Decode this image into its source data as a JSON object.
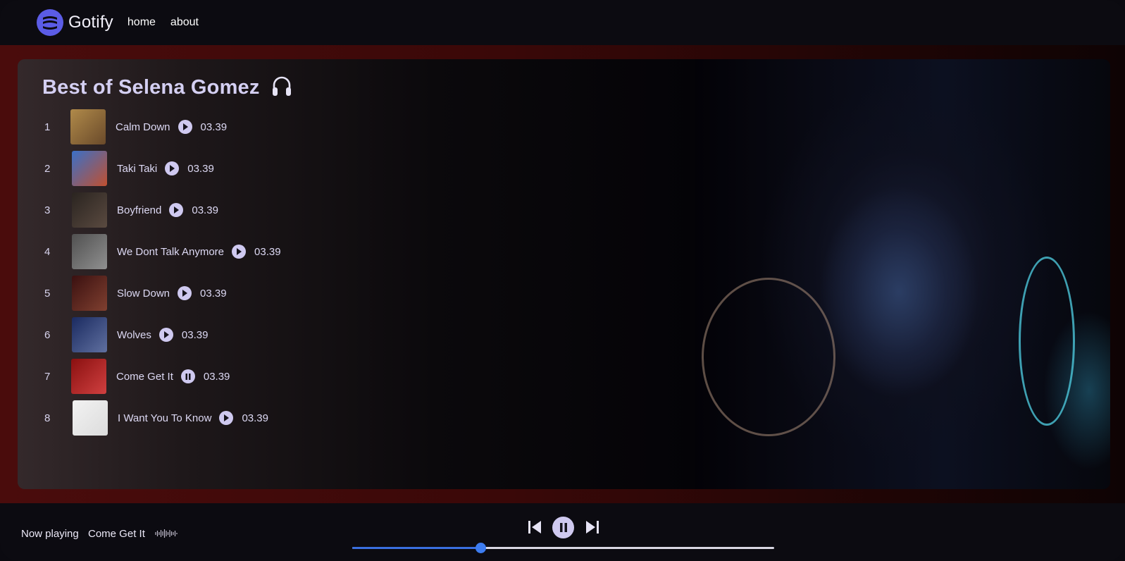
{
  "navbar": {
    "brand": "Gotify",
    "links": [
      "home",
      "about"
    ]
  },
  "playlist": {
    "title": "Best of Selena Gomez",
    "title_icon": "headphones-icon",
    "tracks": [
      {
        "num": "1",
        "name": "Calm Down",
        "duration": "03.39",
        "state": "play",
        "thumb_colors": [
          "#b08a4a",
          "#6a4a2a"
        ]
      },
      {
        "num": "2",
        "name": "Taki Taki",
        "duration": "03.39",
        "state": "play",
        "thumb_colors": [
          "#3a70c8",
          "#c05030"
        ]
      },
      {
        "num": "3",
        "name": "Boyfriend",
        "duration": "03.39",
        "state": "play",
        "thumb_colors": [
          "#2a2420",
          "#5a4a40"
        ]
      },
      {
        "num": "4",
        "name": "We Dont Talk Anymore",
        "duration": "03.39",
        "state": "play",
        "thumb_colors": [
          "#505050",
          "#909090"
        ]
      },
      {
        "num": "5",
        "name": "Slow Down",
        "duration": "03.39",
        "state": "play",
        "thumb_colors": [
          "#3a1010",
          "#804030"
        ]
      },
      {
        "num": "6",
        "name": "Wolves",
        "duration": "03.39",
        "state": "play",
        "thumb_colors": [
          "#1a2a60",
          "#6070a0"
        ]
      },
      {
        "num": "7",
        "name": "Come Get It",
        "duration": "03.39",
        "state": "pause",
        "thumb_colors": [
          "#8a1010",
          "#d04040"
        ]
      },
      {
        "num": "8",
        "name": "I Want You To Know",
        "duration": "03.39",
        "state": "play",
        "thumb_colors": [
          "#f2f2f2",
          "#dcdcdc"
        ]
      }
    ]
  },
  "player": {
    "now_playing_label": "Now playing",
    "now_playing_title": "Come Get It",
    "progress": 0.305,
    "controls": [
      "skip-back-icon",
      "pause-icon",
      "skip-forward-icon"
    ]
  },
  "colors": {
    "accent": "#5b5ce6",
    "button": "#cfc9f0",
    "progress": "#3a6fe0",
    "band": "#4a0c0c"
  }
}
